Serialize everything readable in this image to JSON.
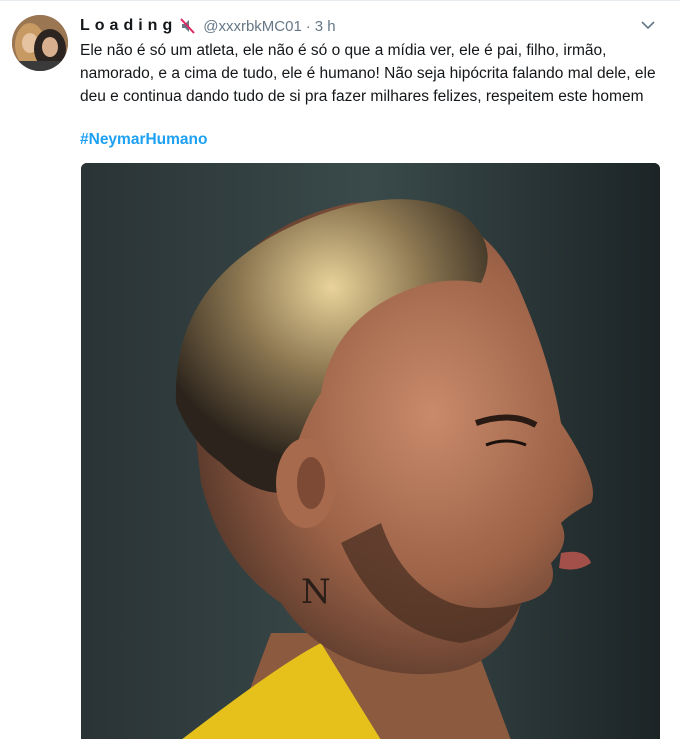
{
  "tweet": {
    "display_name": "Loading",
    "handle": "@xxxrbkMC01",
    "separator": "·",
    "time": "3 h",
    "text": "Ele não é só um atleta, ele não é só o que a mídia ver, ele é pai, filho, irmão, namorado, e a cima de tudo, ele é humano!  Não seja hipócrita falando mal dele, ele deu e continua dando tudo de si pra fazer milhares felizes, respeitem este homem",
    "hashtag": "#NeymarHumano",
    "icons": {
      "muted": "muted-speaker-icon",
      "menu": "chevron-down-icon"
    }
  },
  "colors": {
    "link": "#1da1f2",
    "muted_text": "#657786",
    "text": "#14171a"
  }
}
